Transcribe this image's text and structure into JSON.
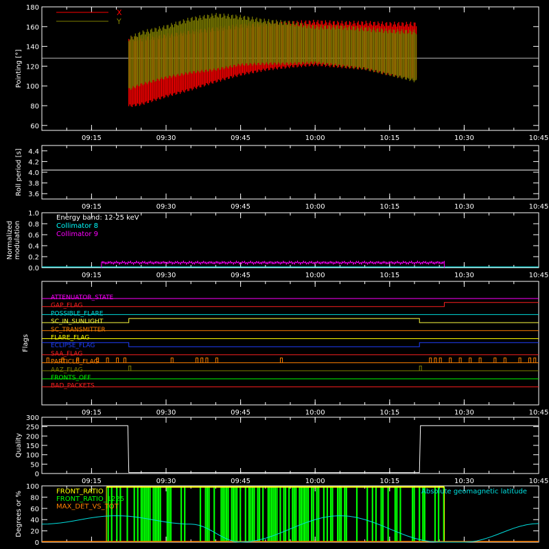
{
  "time_axis": {
    "ticks": [
      "09:15",
      "09:30",
      "09:45",
      "10:00",
      "10:15",
      "10:30",
      "10:45"
    ],
    "range": [
      "09:05",
      "10:45"
    ]
  },
  "chart_data": [
    {
      "type": "area",
      "ylabel": "Pointing [°]",
      "ylim": [
        55,
        180
      ],
      "yticks": [
        "60",
        "80",
        "100",
        "120",
        "140",
        "160",
        "180"
      ],
      "legend": [
        {
          "name": "X",
          "color": "#ff0000"
        },
        {
          "name": "Y",
          "color": "#808000"
        }
      ],
      "reference_line": 128,
      "series": [
        {
          "name": "X",
          "color": "#ff0000",
          "x": [
            "09:22.5",
            "09:25",
            "09:30",
            "09:35",
            "09:40",
            "09:45",
            "09:50",
            "09:55",
            "10:00",
            "10:05",
            "10:10",
            "10:15",
            "10:20.5"
          ],
          "upper": [
            150,
            150,
            153,
            157,
            160,
            163,
            165,
            166,
            167,
            166,
            166,
            165,
            165
          ],
          "lower": [
            78,
            80,
            88,
            95,
            103,
            110,
            115,
            118,
            120,
            118,
            116,
            110,
            105
          ]
        },
        {
          "name": "Y",
          "color": "#808000",
          "x": [
            "09:22.5",
            "09:25",
            "09:30",
            "09:35",
            "09:40",
            "09:45",
            "09:50",
            "09:55",
            "10:00",
            "10:05",
            "10:10",
            "10:15",
            "10:20.5"
          ],
          "upper": [
            150,
            156,
            162,
            170,
            174,
            172,
            168,
            166,
            162,
            162,
            160,
            158,
            157
          ],
          "lower": [
            95,
            100,
            107,
            112,
            115,
            120,
            121,
            121,
            122,
            119,
            116,
            110,
            103
          ]
        }
      ]
    },
    {
      "type": "line",
      "ylabel": "Roll period [s]",
      "ylim": [
        3.5,
        4.5
      ],
      "yticks": [
        "3.6",
        "3.8",
        "4.0",
        "4.2",
        "4.4"
      ],
      "series": [
        {
          "x": [
            "09:05",
            "10:45"
          ],
          "y": [
            4.04,
            4.04
          ],
          "color": "#ffffff"
        }
      ]
    },
    {
      "type": "line",
      "ylabel": "Normalized modulation",
      "ylim": [
        0,
        1.0
      ],
      "yticks": [
        "0.0",
        "0.2",
        "0.4",
        "0.6",
        "0.8",
        "1.0"
      ],
      "annotations": [
        {
          "text": "Energy band: 12-25 keV",
          "color": "#ffffff"
        },
        {
          "text": "Collimator 8",
          "color": "#00ffff"
        },
        {
          "text": "Collimator 9",
          "color": "#ff00ff"
        }
      ],
      "series": [
        {
          "name": "Collimator 8",
          "color": "#00ffff",
          "x": [
            "09:05",
            "10:45"
          ],
          "y": [
            0.0,
            0.0
          ]
        },
        {
          "name": "Collimator 9",
          "color": "#ff00ff",
          "x_start": "09:17",
          "x_end": "10:26",
          "y": [
            0.0,
            0.11,
            0.09,
            0.0
          ]
        }
      ]
    },
    {
      "type": "line",
      "ylabel": "Flags",
      "flags": [
        {
          "name": "ATTENUATOR_STATE",
          "color": "#ff00ff"
        },
        {
          "name": "GAP_FLAG",
          "color": "#ff2020"
        },
        {
          "name": "POSSIBLE_FLARE",
          "color": "#00e0e0"
        },
        {
          "name": "SC_IN_SUNLIGHT",
          "color": "#ffff40"
        },
        {
          "name": "SC_TRANSMITTER",
          "color": "#ff8000"
        },
        {
          "name": "FLARE_FLAG",
          "color": "#ffff00"
        },
        {
          "name": "ECLIPSE_FLAG",
          "color": "#2040ff"
        },
        {
          "name": "SAA_FLAG",
          "color": "#ff2020"
        },
        {
          "name": "PARTICLE_FLAG",
          "color": "#ff8000"
        },
        {
          "name": "AAZ_FLAG",
          "color": "#808000"
        },
        {
          "name": "FRONTS_OFF",
          "color": "#00ff00"
        },
        {
          "name": "BAD_PACKETS",
          "color": "#ff2020"
        }
      ],
      "transitions": {
        "GAP_FLAG": [
          {
            "from": "09:05",
            "to": "10:26",
            "state": 0
          },
          {
            "from": "10:26",
            "to": "10:45",
            "state": 1
          }
        ],
        "SC_IN_SUNLIGHT": [
          {
            "from": "09:05",
            "to": "09:22.5",
            "state": 0
          },
          {
            "from": "09:22.5",
            "to": "10:21",
            "state": 1
          },
          {
            "from": "10:21",
            "to": "10:45",
            "state": 0
          }
        ],
        "ECLIPSE_FLAG": [
          {
            "from": "09:05",
            "to": "09:22.5",
            "state": 1
          },
          {
            "from": "09:22.5",
            "to": "10:21",
            "state": 0
          },
          {
            "from": "10:21",
            "to": "10:45",
            "state": 1
          }
        ],
        "PARTICLE_FLAG_spikes": [
          "09:06",
          "09:09",
          "09:12",
          "09:16",
          "09:18",
          "09:20",
          "09:21.5",
          "09:31",
          "09:36",
          "09:37",
          "09:38",
          "09:40",
          "09:53",
          "10:23",
          "10:24",
          "10:25",
          "10:27",
          "10:29",
          "10:31",
          "10:33",
          "10:36",
          "10:38",
          "10:41",
          "10:43",
          "10:44"
        ],
        "AAZ_FLAG_spikes": [
          "09:22.5",
          "10:21"
        ]
      }
    },
    {
      "type": "line",
      "ylabel": "Quality",
      "ylim": [
        0,
        300
      ],
      "yticks": [
        "0",
        "50",
        "100",
        "150",
        "200",
        "250",
        "300"
      ],
      "series": [
        {
          "color": "#ffffff",
          "x": [
            "09:05",
            "09:22.3",
            "09:22.5",
            "10:21",
            "10:21.2",
            "10:45"
          ],
          "y": [
            255,
            255,
            5,
            5,
            255,
            255
          ]
        }
      ]
    },
    {
      "type": "line",
      "ylabel": "Degrees or %",
      "ylim": [
        0,
        100
      ],
      "yticks": [
        "0",
        "20",
        "40",
        "60",
        "80",
        "100"
      ],
      "legend": [
        {
          "name": "FRONT_RATIO",
          "color": "#ffff00"
        },
        {
          "name": "FRONT_RATIO_1225",
          "color": "#00ff00"
        },
        {
          "name": "MAX_DET_VS_TOT",
          "color": "#ff8000"
        },
        {
          "name": "Absolute geomagnetic latitude",
          "color": "#00e0e0"
        }
      ],
      "series": [
        {
          "name": "Absolute geomagnetic latitude",
          "color": "#00e0e0",
          "x": [
            "09:05",
            "09:20",
            "09:35",
            "09:45",
            "10:05",
            "10:25",
            "10:30",
            "10:45"
          ],
          "y": [
            32,
            47,
            32,
            0,
            47,
            0,
            0,
            33
          ]
        },
        {
          "name": "FRONT_RATIO",
          "color": "#ffff00",
          "x_start": "09:18",
          "x_end": "10:26",
          "y_level": 98
        },
        {
          "name": "FRONT_RATIO_1225",
          "color": "#00ff00",
          "x_start": "09:18",
          "x_end": "10:26",
          "description_level": "dense spikes"
        },
        {
          "name": "MAX_DET_VS_TOT",
          "color": "#ff8000",
          "x_start": "09:18",
          "x_end": "10:26",
          "y_level": 1
        }
      ]
    }
  ]
}
